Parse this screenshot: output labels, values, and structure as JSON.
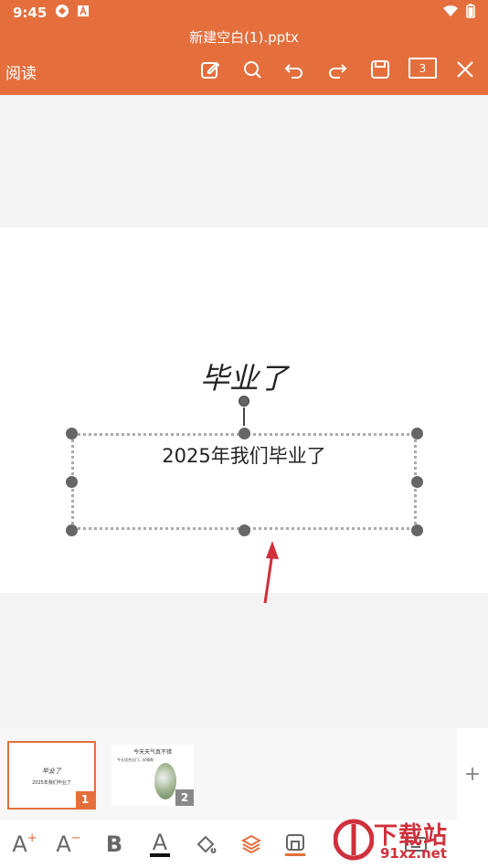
{
  "status_bar": {
    "time": "9:45"
  },
  "app_bar": {
    "file_name": "新建空白(1).pptx",
    "mode_label": "阅读",
    "page_count": "3",
    "icons": [
      "edit-icon",
      "search-icon",
      "undo-icon",
      "redo-icon",
      "save-icon",
      "page-count",
      "close-icon"
    ]
  },
  "slide": {
    "title": "毕业了",
    "text_box": "2025年我们毕业了"
  },
  "thumbnails": [
    {
      "number": "1",
      "title": "毕业了",
      "body": "2025年我们毕业了",
      "selected": true
    },
    {
      "number": "2",
      "title": "今天天气真不错",
      "body": "今天适合出门，好晴和",
      "selected": false
    }
  ],
  "add_slide_label": "+",
  "bottom_toolbar": [
    "font-size-increase-icon",
    "font-size-decrease-icon",
    "bold-icon",
    "font-color-icon",
    "fill-icon",
    "layers-icon",
    "frame-icon",
    "keyboard-icon"
  ],
  "watermark": {
    "main": "下载站",
    "sub": "91xz.net"
  },
  "colors": {
    "accent": "#e46f3d",
    "watermark": "#d0303b"
  }
}
